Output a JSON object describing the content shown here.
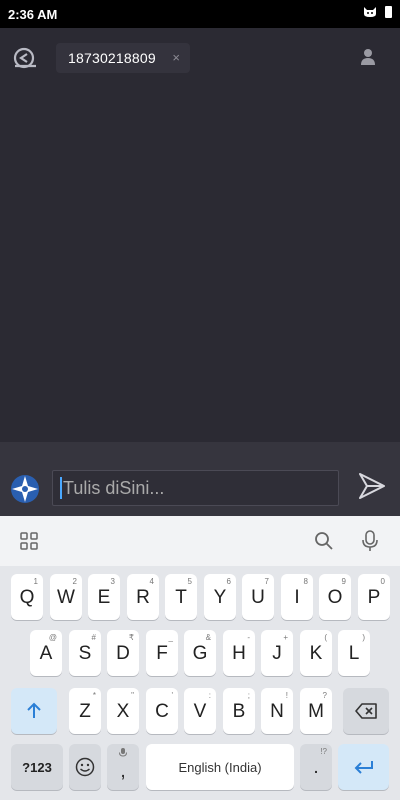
{
  "status_bar": {
    "time": "2:36 AM"
  },
  "header": {
    "recipient": "18730218809",
    "chip_close": "×"
  },
  "compose": {
    "placeholder": "Tulis diSini..."
  },
  "keyboard": {
    "row1": [
      {
        "label": "Q",
        "hint": "1"
      },
      {
        "label": "W",
        "hint": "2"
      },
      {
        "label": "E",
        "hint": "3"
      },
      {
        "label": "R",
        "hint": "4"
      },
      {
        "label": "T",
        "hint": "5"
      },
      {
        "label": "Y",
        "hint": "6"
      },
      {
        "label": "U",
        "hint": "7"
      },
      {
        "label": "I",
        "hint": "8"
      },
      {
        "label": "O",
        "hint": "9"
      },
      {
        "label": "P",
        "hint": "0"
      }
    ],
    "row2": [
      {
        "label": "A",
        "hint": "@"
      },
      {
        "label": "S",
        "hint": "#"
      },
      {
        "label": "D",
        "hint": "₹"
      },
      {
        "label": "F",
        "hint": "_"
      },
      {
        "label": "G",
        "hint": "&"
      },
      {
        "label": "H",
        "hint": "-"
      },
      {
        "label": "J",
        "hint": "+"
      },
      {
        "label": "K",
        "hint": "("
      },
      {
        "label": "L",
        "hint": ")"
      }
    ],
    "row3": [
      {
        "label": "Z",
        "hint": "*"
      },
      {
        "label": "X",
        "hint": "\""
      },
      {
        "label": "C",
        "hint": "'"
      },
      {
        "label": "V",
        "hint": ":"
      },
      {
        "label": "B",
        "hint": ";"
      },
      {
        "label": "N",
        "hint": "!"
      },
      {
        "label": "M",
        "hint": "?"
      }
    ],
    "symbols_label": "?123",
    "comma_label": ",",
    "space_label": "English (India)",
    "period_label": ".",
    "period_hint": "!?"
  }
}
